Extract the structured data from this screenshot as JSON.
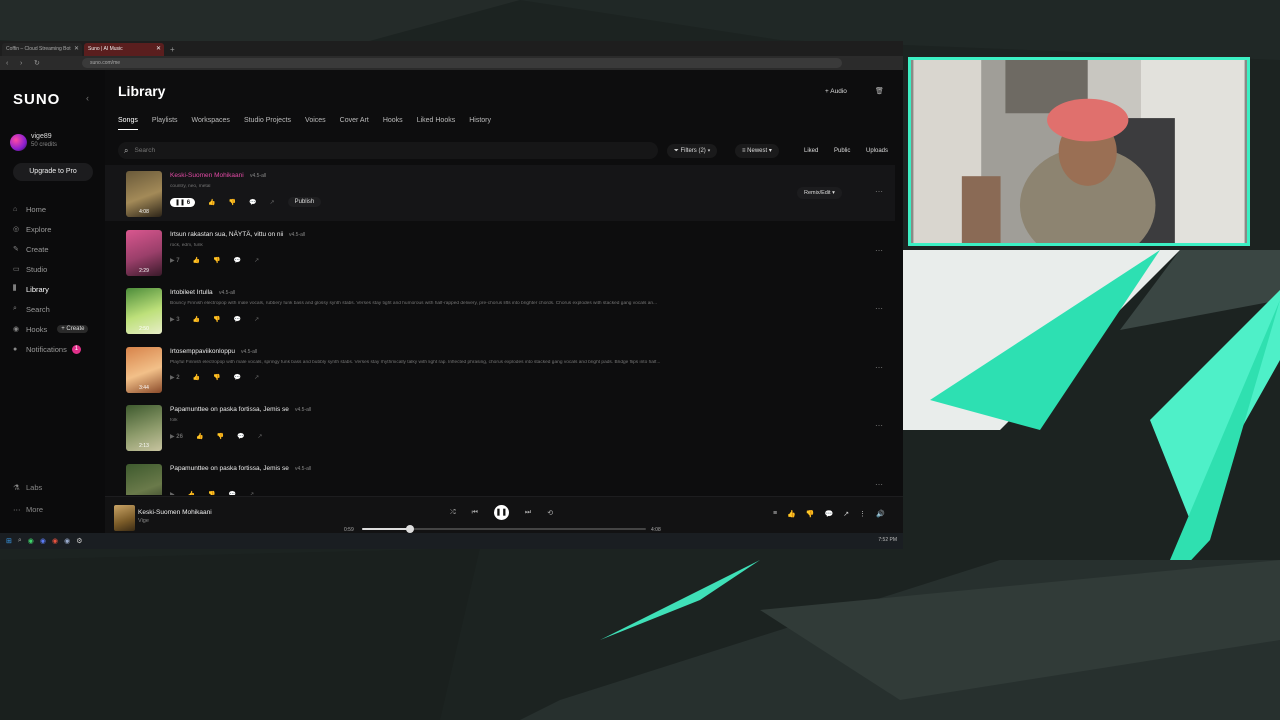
{
  "browser": {
    "tabs": [
      {
        "label": "Coffin – Cloud Streaming Bot"
      },
      {
        "label": "Suno | AI Music"
      }
    ],
    "url": "suno.com/me"
  },
  "sidebar": {
    "logo": "SUNO",
    "user": {
      "name": "vige89",
      "credits": "50 credits"
    },
    "upgrade_label": "Upgrade to Pro",
    "items": [
      {
        "label": "Home",
        "icon": "home-icon"
      },
      {
        "label": "Explore",
        "icon": "compass-icon"
      },
      {
        "label": "Create",
        "icon": "create-icon"
      },
      {
        "label": "Studio",
        "icon": "studio-icon"
      },
      {
        "label": "Library",
        "icon": "library-icon",
        "active": true
      },
      {
        "label": "Search",
        "icon": "search-icon"
      },
      {
        "label": "Hooks",
        "icon": "hooks-icon",
        "pill": "+ Create"
      },
      {
        "label": "Notifications",
        "icon": "bell-icon",
        "badge": "1"
      }
    ],
    "labs": "Labs",
    "more": "More"
  },
  "main": {
    "title": "Library",
    "add_audio": "+ Audio",
    "tabs": [
      {
        "label": "Songs",
        "active": true
      },
      {
        "label": "Playlists"
      },
      {
        "label": "Workspaces"
      },
      {
        "label": "Studio Projects"
      },
      {
        "label": "Voices"
      },
      {
        "label": "Cover Art"
      },
      {
        "label": "Hooks"
      },
      {
        "label": "Liked Hooks"
      },
      {
        "label": "History"
      }
    ],
    "search_placeholder": "Search",
    "filters": "Filters (2)",
    "sort": "Newest",
    "liked": "Liked",
    "public": "Public",
    "uploads": "Uploads",
    "songs": [
      {
        "title": "Keski-Suomen Mohikaani",
        "version": "v4.5-all",
        "desc": "country, neo, metal",
        "duration": "4:08",
        "likes": "6",
        "playing": true,
        "publish": "Publish",
        "remix": "Remix/Edit",
        "art": [
          "#6a5a3a",
          "#a38a58",
          "#2c2418"
        ]
      },
      {
        "title": "Irtsun rakastan sua, NÄYTÄ, vittu on nii",
        "version": "v4.5-all",
        "desc": "rock, edm, funk",
        "duration": "2:29",
        "likes": "7",
        "art": [
          "#d9578f",
          "#9a3f6a",
          "#3a1a2a"
        ]
      },
      {
        "title": "Irtobileet Irtulla",
        "version": "v4.5-all",
        "desc": "Bouncy Finnish electropop with male vocals, rubbery funk bass and glossy synth stabs. Verses stay tight and humorous with half-rapped delivery, pre-chorus lifts into brighter chords. Chorus explodes with stacked gang vocals an...",
        "duration": "2:50",
        "likes": "3",
        "art": [
          "#4c8c3a",
          "#bde07a",
          "#e8eec8"
        ]
      },
      {
        "title": "Irtosemppaviikonloppu",
        "version": "v4.5-all",
        "desc": "Playful Finnish electropop with male vocals, springy funk bass and bubbly synth stabs. Verses stay rhythmically talky with light rap. Inflected phrasing, chorus explodes into stacked gang vocals and bright pads. Bridge flips into half...",
        "duration": "3:44",
        "likes": "2",
        "art": [
          "#d7834a",
          "#f2c089",
          "#8a4a2a"
        ]
      },
      {
        "title": "Papamunttee on paska fortissa, Jemis se",
        "version": "v4.5-all",
        "desc": "folk",
        "duration": "2:13",
        "likes": "26",
        "art": [
          "#3e5a2e",
          "#8c9a6a",
          "#c8c4a0"
        ]
      },
      {
        "title": "Papamunttee on paska fortissa, Jemis se",
        "version": "v4.5-all",
        "desc": "",
        "duration": "",
        "likes": "",
        "art": [
          "#3e5a2e",
          "#6a7a4a",
          "#2a3420"
        ]
      }
    ]
  },
  "player": {
    "title": "Keski-Suomen Mohikaani",
    "artist": "Vige",
    "current_time": "0:59",
    "total_time": "4:08",
    "progress": 0.17
  },
  "taskbar": {
    "clock": "7:52 PM"
  }
}
